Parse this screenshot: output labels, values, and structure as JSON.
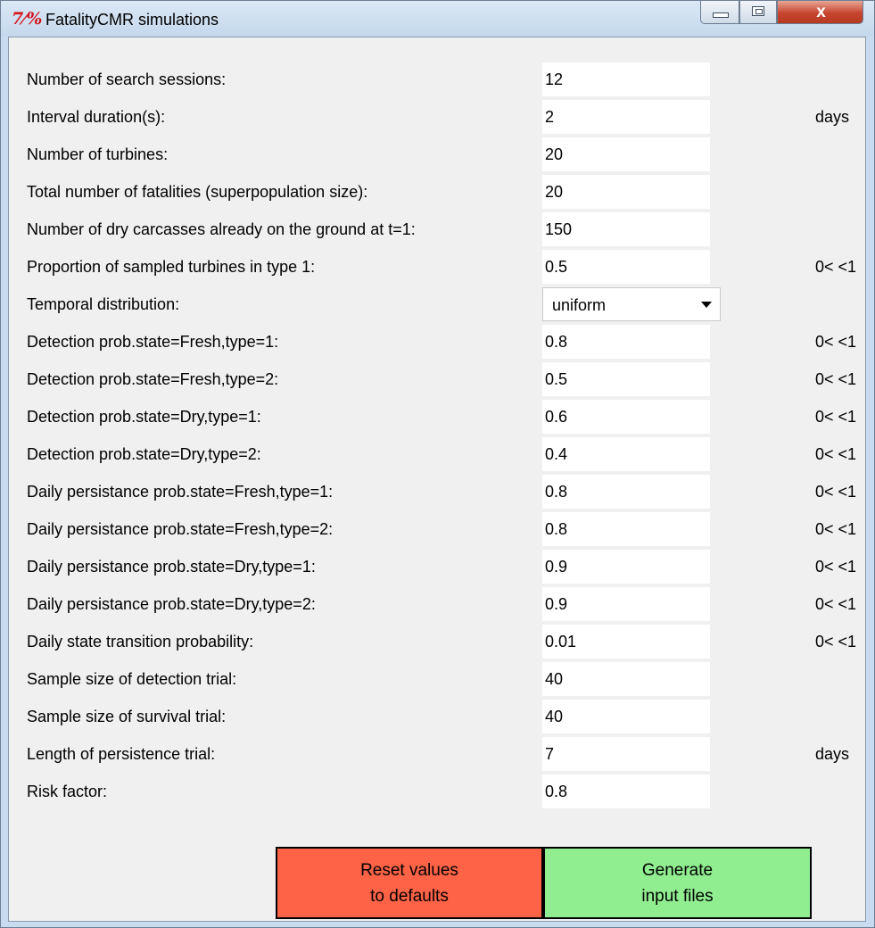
{
  "window": {
    "title": "FatalityCMR simulations",
    "icon_text": "7⁄%",
    "close_glyph": "x"
  },
  "fields": [
    {
      "label": "Number of search sessions:",
      "value": "12",
      "unit": ""
    },
    {
      "label": "Interval duration(s):",
      "value": "2",
      "unit": "days"
    },
    {
      "label": "Number of turbines:",
      "value": "20",
      "unit": ""
    },
    {
      "label": "Total number of fatalities (superpopulation size):",
      "value": "20",
      "unit": ""
    },
    {
      "label": "Number of dry carcasses already on the ground at t=1:",
      "value": "150",
      "unit": ""
    },
    {
      "label": "Proportion of sampled turbines in type 1:",
      "value": "0.5",
      "unit": "0< <1"
    },
    {
      "label": "Temporal distribution:",
      "value": "uniform",
      "unit": ""
    },
    {
      "label": "Detection prob.state=Fresh,type=1:",
      "value": "0.8",
      "unit": "0< <1"
    },
    {
      "label": "Detection prob.state=Fresh,type=2:",
      "value": "0.5",
      "unit": "0< <1"
    },
    {
      "label": "Detection prob.state=Dry,type=1:",
      "value": "0.6",
      "unit": "0< <1"
    },
    {
      "label": "Detection prob.state=Dry,type=2:",
      "value": "0.4",
      "unit": "0< <1"
    },
    {
      "label": "Daily persistance prob.state=Fresh,type=1:",
      "value": "0.8",
      "unit": "0< <1"
    },
    {
      "label": "Daily persistance prob.state=Fresh,type=2:",
      "value": "0.8",
      "unit": "0< <1"
    },
    {
      "label": "Daily persistance prob.state=Dry,type=1:",
      "value": "0.9",
      "unit": "0< <1"
    },
    {
      "label": "Daily persistance prob.state=Dry,type=2:",
      "value": "0.9",
      "unit": "0< <1"
    },
    {
      "label": "Daily state transition probability:",
      "value": "0.01",
      "unit": "0< <1"
    },
    {
      "label": "Sample size of detection trial:",
      "value": "40",
      "unit": ""
    },
    {
      "label": "Sample size of survival trial:",
      "value": "40",
      "unit": ""
    },
    {
      "label": "Length of persistence trial:",
      "value": "7",
      "unit": "days"
    },
    {
      "label": "Risk factor:",
      "value": "0.8",
      "unit": ""
    }
  ],
  "buttons": {
    "reset": {
      "line1": "Reset values",
      "line2": "to defaults",
      "color": "#ff6347"
    },
    "generate": {
      "line1": "Generate",
      "line2": "input files",
      "color": "#90ee90"
    }
  }
}
